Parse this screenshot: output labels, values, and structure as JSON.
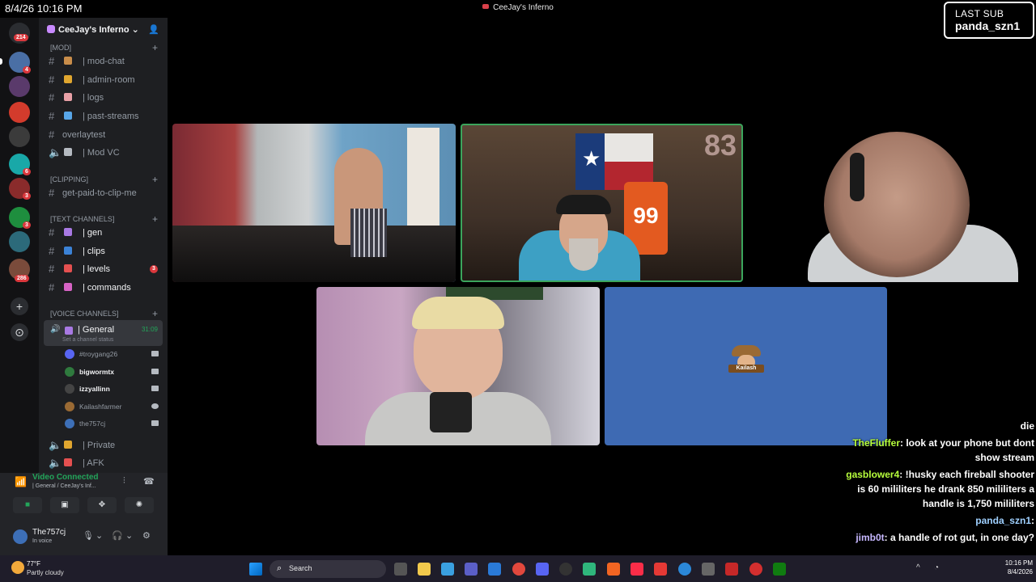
{
  "overlay": {
    "timestamp": "8/4/26 10:16 PM",
    "last_sub_label": "LAST SUB",
    "last_sub_name": "panda_szn1"
  },
  "window": {
    "title": "CeeJay's Inferno"
  },
  "rail": {
    "badges": [
      "214",
      "4",
      "6",
      "3",
      "3",
      "286"
    ]
  },
  "sidebar": {
    "guild_name": "CeeJay's Inferno",
    "categories": [
      {
        "label": "[MOD]"
      },
      {
        "label": "[CLIPPING]"
      },
      {
        "label": "[TEXT CHANNELS]"
      },
      {
        "label": "[VOICE CHANNELS]"
      }
    ],
    "channels": [
      {
        "label": "| mod-chat",
        "icon": "hammer-icon",
        "color": "#c98d4a"
      },
      {
        "label": "| admin-room",
        "icon": "lock-icon",
        "color": "#e0a62f"
      },
      {
        "label": "| logs",
        "icon": "page-icon",
        "color": "#e8a0a6"
      },
      {
        "label": "| past-streams",
        "icon": "rewind-icon",
        "color": "#58a6e8"
      },
      {
        "label": "overlaytest"
      },
      {
        "label": "| Mod VC",
        "icon": "headphones-icon",
        "color": "#b5bac1"
      },
      {
        "label": "get-paid-to-clip-me"
      },
      {
        "label": "| gen",
        "icon": "gamepad-icon",
        "color": "#a879e3"
      },
      {
        "label": "| clips",
        "icon": "film-icon",
        "color": "#3b82d6"
      },
      {
        "label": "| levels",
        "icon": "thermometer-icon",
        "color": "#e45050",
        "mention": "3"
      },
      {
        "label": "| commands",
        "icon": "commands-icon",
        "color": "#d663c4"
      }
    ],
    "voice": {
      "active_channel": "| General",
      "active_time": "31:09",
      "status": "Set a channel status",
      "users": [
        "#troygang26",
        "bigwormtx",
        "izzyallinn",
        "Kailashfarmer",
        "the757cj"
      ],
      "other_channels": [
        "| Private",
        "| AFK"
      ]
    }
  },
  "voice_panel": {
    "connected": "Video Connected",
    "location": "| General / CeeJay's Inf...",
    "user_name": "The757cj",
    "user_status": "In voice"
  },
  "tiles": {
    "jersey_number": "99",
    "avatar_label": "Kailash"
  },
  "chat": [
    {
      "user": "",
      "text": "die"
    },
    {
      "user": "TheFluffer",
      "text": ": look at your phone but dont show stream",
      "color": "green"
    },
    {
      "user": "gasblower4",
      "text": ": !husky each fireball shooter is 60 mililiters he drank 850 mililiters a handle is 1,750 mililiters",
      "color": "green"
    },
    {
      "user": "panda_szn1",
      "text": ":",
      "color": "blue"
    },
    {
      "user": "jimb0t",
      "text": ": a handle of rot gut, in one day?",
      "color": "purple"
    }
  ],
  "taskbar": {
    "temperature": "77°F",
    "condition": "Partly cloudy",
    "search_placeholder": "Search",
    "time": "10:16 PM",
    "date": "8/4/2026"
  }
}
